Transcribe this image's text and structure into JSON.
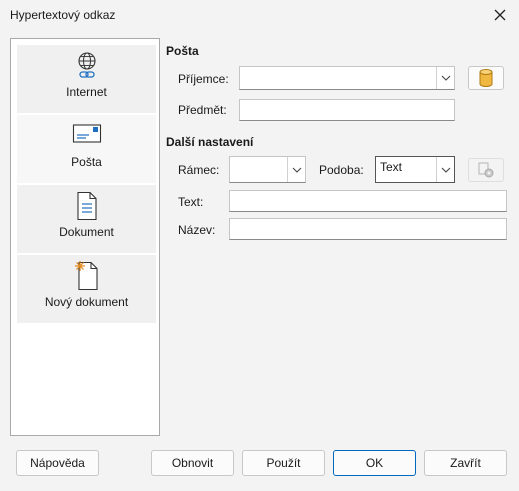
{
  "window": {
    "title": "Hypertextový odkaz"
  },
  "sidebar": {
    "items": [
      {
        "label": "Internet",
        "icon": "globe-link-icon",
        "selected": false
      },
      {
        "label": "Pošta",
        "icon": "envelope-icon",
        "selected": true
      },
      {
        "label": "Dokument",
        "icon": "document-icon",
        "selected": false
      },
      {
        "label": "Nový dokument",
        "icon": "new-document-icon",
        "selected": false
      }
    ]
  },
  "mail": {
    "section_title": "Pošta",
    "recipient_label": "Příjemce:",
    "recipient_value": "",
    "subject_label": "Předmět:",
    "subject_value": ""
  },
  "more": {
    "section_title": "Další nastavení",
    "frame_label": "Rámec:",
    "frame_value": "",
    "form_label": "Podoba:",
    "form_value": "Text",
    "text_label": "Text:",
    "text_value": "",
    "name_label": "Název:",
    "name_value": ""
  },
  "buttons": {
    "help": "Nápověda",
    "reset": "Obnovit",
    "apply": "Použít",
    "ok": "OK",
    "close": "Zavřít"
  },
  "colors": {
    "accent": "#0067c0",
    "db_icon": "#f0b840"
  }
}
